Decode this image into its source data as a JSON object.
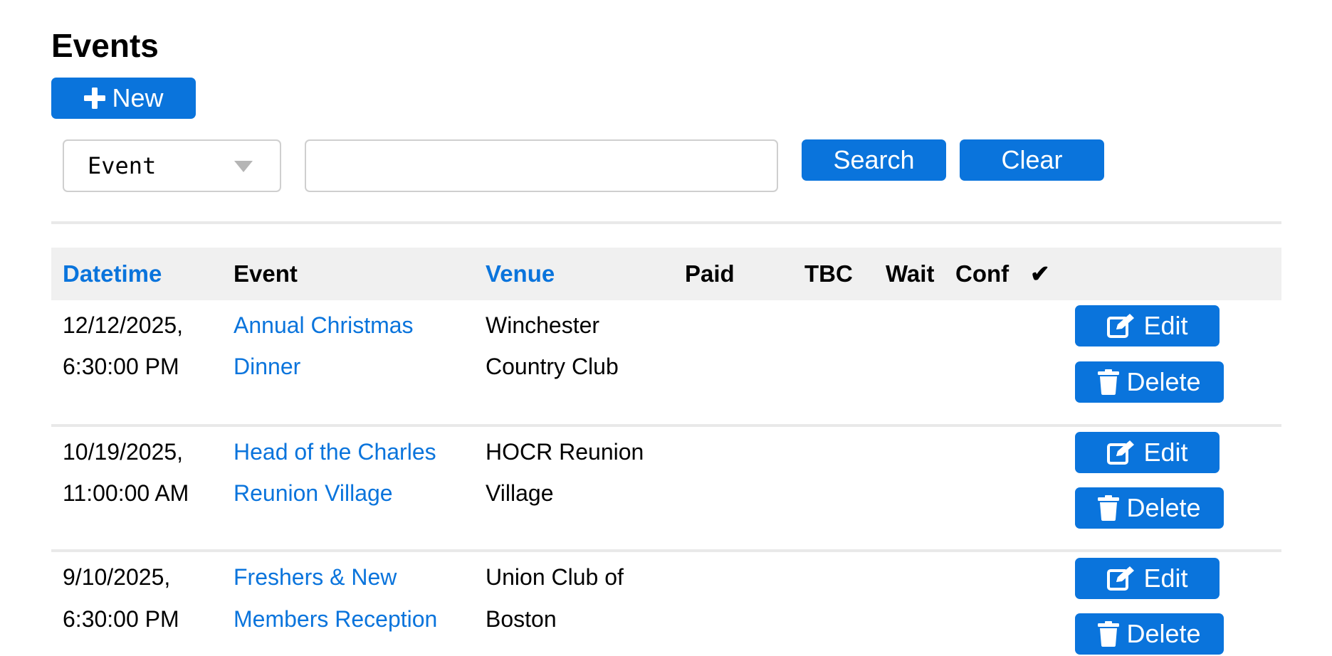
{
  "header": {
    "title": "Events",
    "new_label": "New"
  },
  "search": {
    "field_select": "Event",
    "query_value": "",
    "search_label": "Search",
    "clear_label": "Clear"
  },
  "table": {
    "columns": [
      "Datetime",
      "Event",
      "Venue",
      "Paid",
      "TBC",
      "Wait",
      "Conf",
      "✔"
    ],
    "rows": [
      {
        "datetime_line1": "12/12/2025,",
        "datetime_line2": "6:30:00 PM",
        "event_line1": "Annual Christmas",
        "event_line2": "Dinner",
        "venue_line1": "Winchester",
        "venue_line2": "Country Club",
        "edit_label": "Edit",
        "delete_label": "Delete"
      },
      {
        "datetime_line1": "10/19/2025,",
        "datetime_line2": "11:00:00 AM",
        "event_line1": "Head of the Charles",
        "event_line2": "Reunion Village",
        "venue_line1": "HOCR Reunion",
        "venue_line2": "Village",
        "edit_label": "Edit",
        "delete_label": "Delete"
      },
      {
        "datetime_line1": "9/10/2025,",
        "datetime_line2": "6:30:00 PM",
        "event_line1": "Freshers & New",
        "event_line2": "Members Reception",
        "venue_line1": "Union Club of",
        "venue_line2": "Boston",
        "edit_label": "Edit",
        "delete_label": "Delete"
      }
    ]
  },
  "colors": {
    "accent": "#0a74dc",
    "header_bg": "#f0f0f0",
    "divider": "#e9e9e9"
  },
  "icons": {
    "new": "plus-icon",
    "select": "chevron-down-icon",
    "edit": "edit-icon",
    "delete": "trash-icon"
  }
}
